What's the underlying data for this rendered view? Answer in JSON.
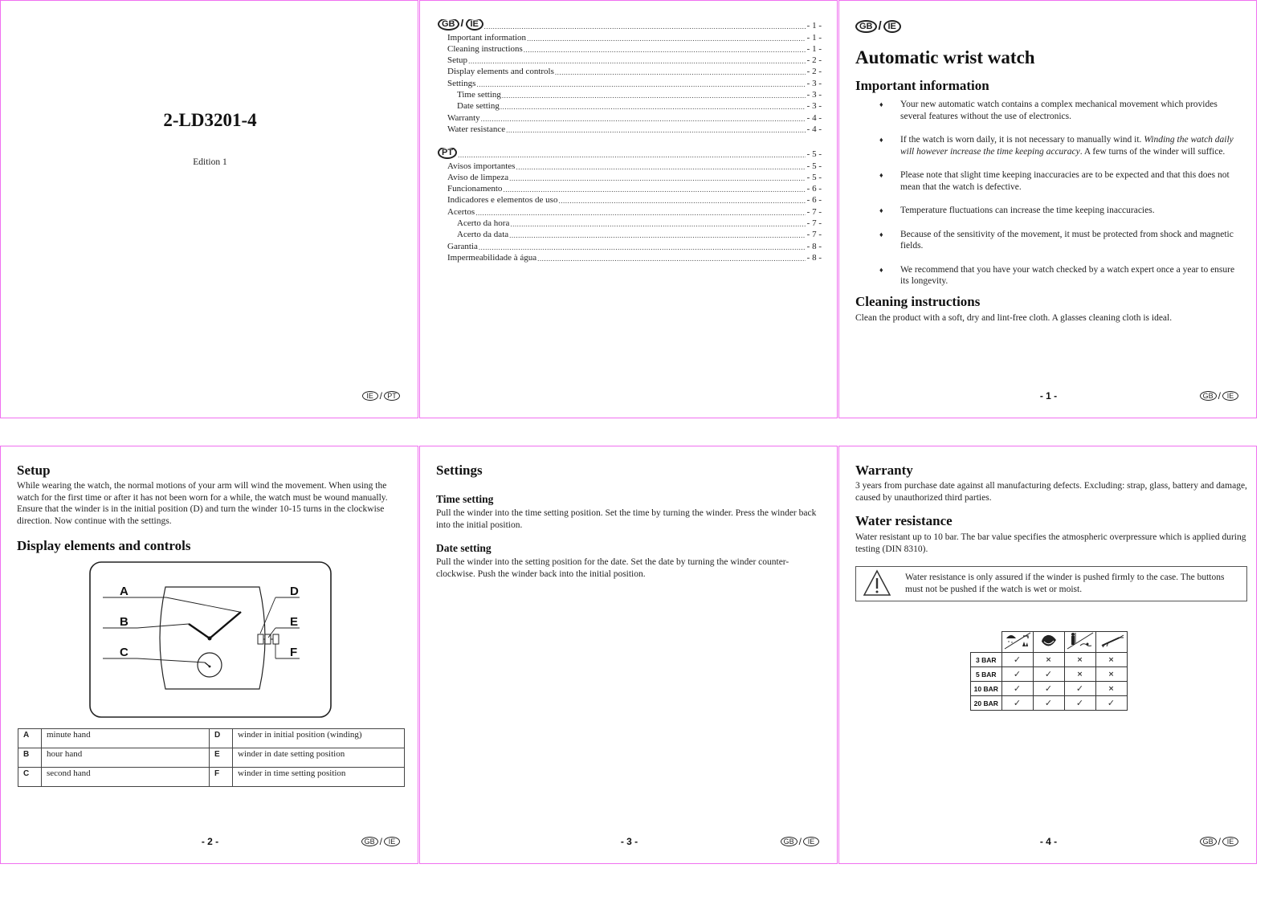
{
  "cover": {
    "model": "2-LD3201-4",
    "edition": "Edition 1",
    "badges": [
      "IE",
      "PT"
    ]
  },
  "toc": {
    "sections": [
      {
        "badges": [
          "GB",
          "IE"
        ],
        "page": "- 1 -",
        "items": [
          {
            "label": "Important information",
            "page": "- 1 -",
            "level": 1
          },
          {
            "label": "Cleaning instructions",
            "page": "- 1 -",
            "level": 1
          },
          {
            "label": "Setup",
            "page": "- 2 -",
            "level": 1
          },
          {
            "label": "Display elements and controls",
            "page": "- 2 -",
            "level": 1
          },
          {
            "label": "Settings",
            "page": "- 3 -",
            "level": 1
          },
          {
            "label": "Time setting",
            "page": "- 3 -",
            "level": 2
          },
          {
            "label": "Date setting",
            "page": "- 3 -",
            "level": 2
          },
          {
            "label": "Warranty",
            "page": "- 4 -",
            "level": 1
          },
          {
            "label": "Water resistance",
            "page": "- 4 -",
            "level": 1
          }
        ]
      },
      {
        "badges": [
          "PT"
        ],
        "page": "- 5 -",
        "items": [
          {
            "label": "Avisos importantes",
            "page": "- 5 -",
            "level": 1
          },
          {
            "label": "Aviso de limpeza",
            "page": "- 5 -",
            "level": 1
          },
          {
            "label": "Funcionamento",
            "page": "- 6 -",
            "level": 1
          },
          {
            "label": "Indicadores e elementos de uso",
            "page": "- 6 -",
            "level": 1
          },
          {
            "label": "Acertos",
            "page": "- 7 -",
            "level": 1
          },
          {
            "label": "Acerto da hora",
            "page": "- 7 -",
            "level": 2
          },
          {
            "label": "Acerto da data",
            "page": "- 7 -",
            "level": 2
          },
          {
            "label": "Garantia",
            "page": "- 8 -",
            "level": 1
          },
          {
            "label": "Impermeabilidade à água",
            "page": "- 8 -",
            "level": 1
          }
        ]
      }
    ]
  },
  "page1": {
    "badges": [
      "GB",
      "IE"
    ],
    "title": "Automatic wrist watch",
    "important_heading": "Important information",
    "bullets": [
      {
        "text": "Your new automatic watch contains a complex mechanical movement which provides several features without the use of electronics."
      },
      {
        "text_before": "If the watch is worn daily, it is not necessary to manually wind it. ",
        "italic": "Winding the watch daily will however increase the time keeping accuracy",
        "text_after": ". A few turns of the winder will suffice."
      },
      {
        "text": "Please note that slight time keeping inaccuracies are to be expected and that this does not mean that the watch is defective."
      },
      {
        "text": "Temperature fluctuations can increase the time keeping inaccuracies."
      },
      {
        "text": "Because of the sensitivity of the movement, it must be protected from shock and magnetic fields."
      },
      {
        "text": "We recommend that you have your watch checked by a watch expert once a year to ensure its longevity."
      }
    ],
    "bullet_symbol": "♦",
    "cleaning_heading": "Cleaning instructions",
    "cleaning_text": "Clean the product with a soft, dry and lint-free cloth. A glasses cleaning cloth is ideal.",
    "page_num": "- 1 -",
    "footer_badges": [
      "GB",
      "IE"
    ]
  },
  "page2": {
    "setup_heading": "Setup",
    "setup_text": "While wearing the watch, the normal motions of your arm will wind the movement. When using the watch for the first time or after it has not been worn for a while, the watch must be wound manually. Ensure that the winder is in the initial position (D) and turn the winder 10-15 turns in the clockwise direction. Now continue with the settings.",
    "display_heading": "Display elements and controls",
    "figure_labels": [
      "A",
      "B",
      "C",
      "D",
      "E",
      "F"
    ],
    "legend": [
      {
        "left_key": "A",
        "left_desc": "minute hand",
        "right_key": "D",
        "right_desc": "winder in initial position (winding)"
      },
      {
        "left_key": "B",
        "left_desc": "hour hand",
        "right_key": "E",
        "right_desc": "winder in date setting position"
      },
      {
        "left_key": "C",
        "left_desc": "second hand",
        "right_key": "F",
        "right_desc": "winder in time setting position"
      }
    ],
    "page_num": "- 2 -",
    "footer_badges": [
      "GB",
      "IE"
    ]
  },
  "page3": {
    "settings_heading": "Settings",
    "time_heading": "Time setting",
    "time_text": "Pull the winder into the time setting position. Set the time by turning the winder. Press the winder back into the initial position.",
    "date_heading": "Date setting",
    "date_text": "Pull the winder into the setting position for the date. Set the date by turning the winder counter-clockwise. Push the winder back into the initial position.",
    "page_num": "- 3 -",
    "footer_badges": [
      "GB",
      "IE"
    ]
  },
  "page4": {
    "warranty_heading": "Warranty",
    "warranty_text": "3 years from purchase date against all manufacturing defects. Excluding: strap, glass, battery and damage, caused by unauthorized third parties.",
    "water_heading": "Water resistance",
    "water_text": "Water resistant up to 10 bar. The bar value specifies the atmospheric overpressure which is applied during testing (DIN 8310).",
    "warning_icon": "warning-triangle-icon",
    "warning_text": "Water resistance is only assured if the winder is pushed firmly to the case.  The buttons must not be pushed if the watch is wet or moist.",
    "bar_table": {
      "columns": [
        "rain-splash-icon",
        "bathing-icon",
        "swimming-shower-icon",
        "diving-icon"
      ],
      "rows": [
        {
          "label": "3 BAR",
          "values": [
            "✓",
            "×",
            "×",
            "×"
          ]
        },
        {
          "label": "5 BAR",
          "values": [
            "✓",
            "✓",
            "×",
            "×"
          ]
        },
        {
          "label": "10 BAR",
          "values": [
            "✓",
            "✓",
            "✓",
            "×"
          ]
        },
        {
          "label": "20 BAR",
          "values": [
            "✓",
            "✓",
            "✓",
            "✓"
          ]
        }
      ]
    },
    "page_num": "- 4 -",
    "footer_badges": [
      "GB",
      "IE"
    ]
  },
  "colors": {
    "page_border": "#f070f0",
    "text": "#1a1a1a"
  }
}
